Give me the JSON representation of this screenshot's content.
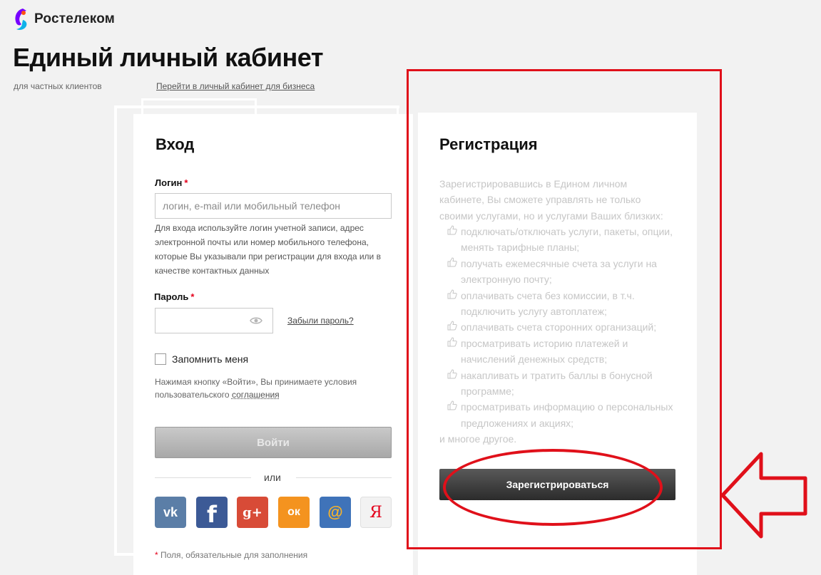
{
  "brand": {
    "name": "Ростелеком",
    "accent": "#7700ff",
    "accent2": "#ff4f12"
  },
  "header": {
    "title": "Единый личный кабинет",
    "subtitle": "для частных клиентов",
    "business_link": "Перейти в личный кабинет для бизнеса"
  },
  "login": {
    "title": "Вход",
    "login_label": "Логин",
    "required_mark": "*",
    "login_placeholder": "логин, e-mail или мобильный телефон",
    "login_hint": "Для входа используйте логин учетной записи, адрес электронной почты или номер мобильного телефона, которые Вы указывали при регистрации для входа или в качестве контактных данных",
    "password_label": "Пароль",
    "forgot_link": "Забыли пароль?",
    "remember_label": "Запомнить меня",
    "terms_prefix": "Нажимая кнопку «Войти», Вы принимаете условия пользовательского ",
    "terms_link": "соглашения",
    "submit_label": "Войти",
    "or_label": "или",
    "social": [
      {
        "name": "vk",
        "glyph": "vk",
        "color": "#5b7ea7"
      },
      {
        "name": "facebook",
        "glyph": "f",
        "color": "#3c5a96"
      },
      {
        "name": "google-plus",
        "glyph": "g+",
        "color": "#d84b37"
      },
      {
        "name": "odnoklassniki",
        "glyph": "ок",
        "color": "#f4931f"
      },
      {
        "name": "mail-ru",
        "glyph": "@",
        "color": "#3f73b9"
      },
      {
        "name": "yandex",
        "glyph": "Я",
        "color": "#f2f2f2"
      }
    ],
    "required_note": "Поля, обязательные для заполнения"
  },
  "registration": {
    "title": "Регистрация",
    "intro": "Зарегистрировавшись в Едином личном кабинете, Вы сможете управлять не только своими услугами, но и услугами Ваших близких:",
    "items": [
      "подключать/отключать услуги, пакеты, опции, менять тарифные планы;",
      "получать ежемесячные счета за услуги на электронную почту;",
      "оплачивать счета без комиссии, в т.ч. подключить услугу автоплатеж;",
      "оплачивать счета сторонних организаций;",
      "просматривать историю платежей и начислений денежных средств;",
      "накапливать и тратить баллы в бонусной программе;",
      "просматривать информацию о персональных предложениях и акциях;"
    ],
    "outro": "и многое другое.",
    "button_label": "Зарегистрироваться"
  },
  "annotation": {
    "color": "#e0101a"
  }
}
